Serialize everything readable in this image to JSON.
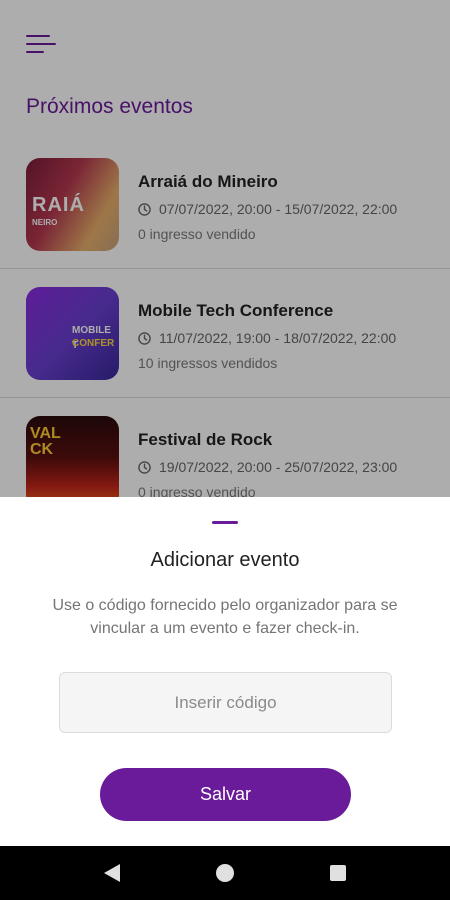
{
  "header": {
    "menu_icon": "hamburger-menu-icon",
    "page_title": "Próximos eventos"
  },
  "events": [
    {
      "name": "Arraiá do Mineiro",
      "date": "07/07/2022, 20:00 - 15/07/2022, 22:00",
      "sold": "0 ingresso vendido",
      "thumb_text": "RAIÁ",
      "thumb_subtext": "NEIRO"
    },
    {
      "name": "Mobile Tech Conference",
      "date": "11/07/2022, 19:00 - 18/07/2022, 22:00",
      "sold": "10 ingressos vendidos",
      "thumb_text": "MOBILE T",
      "thumb_subtext": "CONFER"
    },
    {
      "name": "Festival de Rock",
      "date": "19/07/2022, 20:00 - 25/07/2022, 23:00",
      "sold": "0 ingresso vendido",
      "thumb_text": "VAL\nCK",
      "thumb_subtext": ""
    }
  ],
  "sheet": {
    "title": "Adicionar evento",
    "description": "Use o código fornecido pelo organizador para se vincular a um evento e fazer check-in.",
    "input_placeholder": "Inserir código",
    "input_value": "",
    "save_label": "Salvar"
  },
  "colors": {
    "accent": "#6a1b9a",
    "overlay": "rgba(0,0,0,0.32)",
    "navbar": "#000000"
  },
  "navbar": {
    "back_icon": "back-triangle-icon",
    "home_icon": "home-circle-icon",
    "recent_icon": "recent-apps-square-icon"
  }
}
